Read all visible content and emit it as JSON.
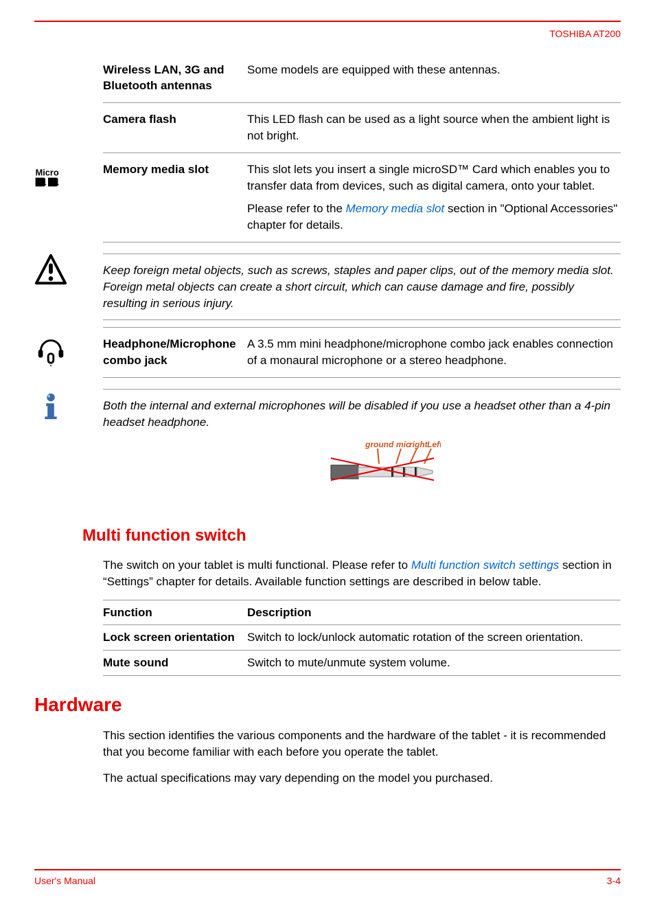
{
  "header": {
    "product": "TOSHIBA AT200"
  },
  "hw_rows": {
    "wifi": {
      "label": "Wireless LAN, 3G and Bluetooth antennas",
      "desc": "Some models are equipped with these antennas."
    },
    "flash": {
      "label": "Camera flash",
      "desc": "This LED flash can be used as a light source when the ambient light is not bright."
    },
    "memslot": {
      "label": "Memory media slot",
      "desc1_a": "This slot lets you insert a single microSD™ Card which enables you to transfer data from devices, such as digital camera, onto your tablet.",
      "desc2_prefix": "Please refer to the ",
      "desc2_link": "Memory media slot",
      "desc2_suffix": " section in \"Optional Accessories\" chapter for details."
    },
    "headphone": {
      "label": "Headphone/Microphone combo jack",
      "desc": "A 3.5 mm mini headphone/microphone combo jack enables connection of a monaural microphone or a stereo headphone."
    }
  },
  "caution_note": "Keep foreign metal objects, such as screws, staples and paper clips, out of the memory media slot. Foreign metal objects can create a short circuit, which can cause damage and fire, possibly resulting in serious injury.",
  "info_note": "Both the internal and external microphones will be disabled if you use a headset other than a 4-pin headset headphone.",
  "plug_labels": "ground mic right Left",
  "multi_switch": {
    "heading": "Multi function switch",
    "intro_prefix": "The switch on your tablet is multi functional. Please refer to ",
    "intro_link": "Multi function switch settings",
    "intro_suffix": " section in “Settings” chapter for details. Available function settings are described in below table.",
    "headers": {
      "func": "Function",
      "desc": "Description"
    },
    "rows": [
      {
        "func": "Lock screen orientation",
        "desc": "Switch to lock/unlock automatic rotation of the screen orientation."
      },
      {
        "func": "Mute sound",
        "desc": "Switch to mute/unmute system volume."
      }
    ]
  },
  "hardware_section": {
    "heading": "Hardware",
    "p1": "This section identifies the various components and the hardware of the tablet - it is recommended that you become familiar with each before you operate the tablet.",
    "p2": "The actual specifications may vary depending on the model you purchased."
  },
  "footer": {
    "manual": "User's Manual",
    "page": "3-4"
  },
  "icons": {
    "micro_sd": "micro-sd-icon",
    "headphone": "headphone-mic-icon",
    "caution": "caution-icon",
    "info": "info-icon"
  }
}
